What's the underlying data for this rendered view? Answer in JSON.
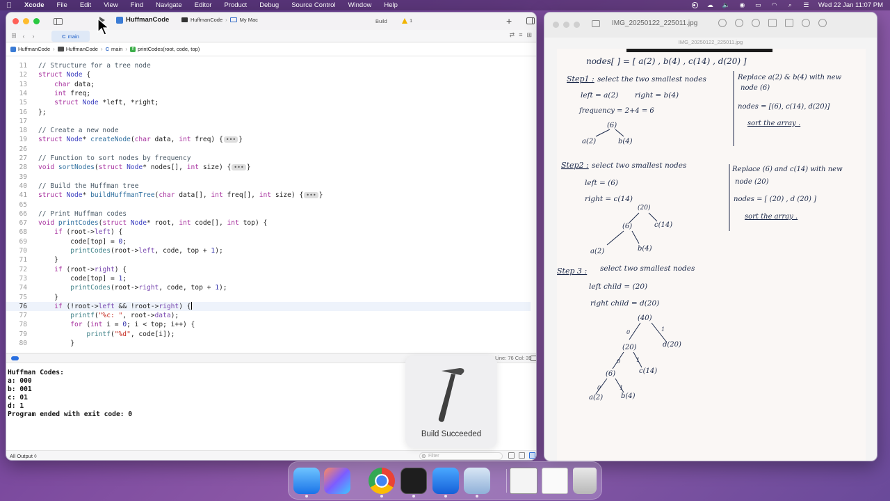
{
  "menubar": {
    "app_name": "Xcode",
    "items": [
      "File",
      "Edit",
      "View",
      "Find",
      "Navigate",
      "Editor",
      "Product",
      "Debug",
      "Source Control",
      "Window",
      "Help"
    ],
    "datetime": "Wed 22 Jan  11:07 PM"
  },
  "xcode": {
    "project_name": "HuffmanCode",
    "scheme": "HuffmanCode",
    "destination": "My Mac",
    "build_status": "Build",
    "warning_count": "1",
    "tab_label": "main",
    "breadcrumb": [
      "HuffmanCode",
      "HuffmanCode",
      "main",
      "printCodes(root, code, top)"
    ],
    "cursor_position": "Line: 76  Col: 39",
    "console_lines": [
      "Huffman Codes:",
      "a: 000",
      "b: 001",
      "c: 01",
      "d: 1",
      "Program ended with exit code: 0"
    ],
    "output_selector": "All Output ◊",
    "filter_placeholder": "Filter",
    "hud_text": "Build Succeeded"
  },
  "preview": {
    "title": "IMG_20250122_225011.jpg",
    "subtitle": "IMG_20250122_225011.jpg",
    "notes": {
      "line1": "nodes[ ] = [ a(2) , b(4) , c(14) , d(20) ]",
      "step1_label": "Step1 :",
      "step1_title": "select the two smallest nodes",
      "step1_left": "left = a(2)",
      "step1_right": "right = b(4)",
      "step1_freq": "frequency = 2+4 = 6",
      "step1_replace1": "Replace a(2) & b(4) with new",
      "step1_replace2": "node (6)",
      "step1_nodes": "nodes = [(6), c(14), d(20)]",
      "step1_sort": "sort the array .",
      "step2_label": "Step2 :",
      "step2_title": "select two smallest nodes",
      "step2_left": "left = (6)",
      "step2_right": "right = c(14)",
      "step2_replace1": "Replace (6) and c(14) with new",
      "step2_replace2": "node (20)",
      "step2_nodes": "nodes = [ (20) , d (20) ]",
      "step2_sort": "sort the array .",
      "step3_label": "Step 3 :",
      "step3_title": "select two smallest nodes",
      "step3_left": "left child = (20)",
      "step3_right": "right child = d(20)",
      "tree_40": "(40)",
      "tree_20": "(20)",
      "tree_6": "(6)",
      "tree_a": "a(2)",
      "tree_b": "b(4)",
      "tree_c": "c(14)",
      "tree_d": "d(20)",
      "zero": "0",
      "one": "1"
    }
  },
  "colors": {
    "keyword": "#a7309e",
    "type": "#3a3ec0",
    "comment": "#4a5a67",
    "string": "#c4251b",
    "accent": "#2a6fe0"
  }
}
